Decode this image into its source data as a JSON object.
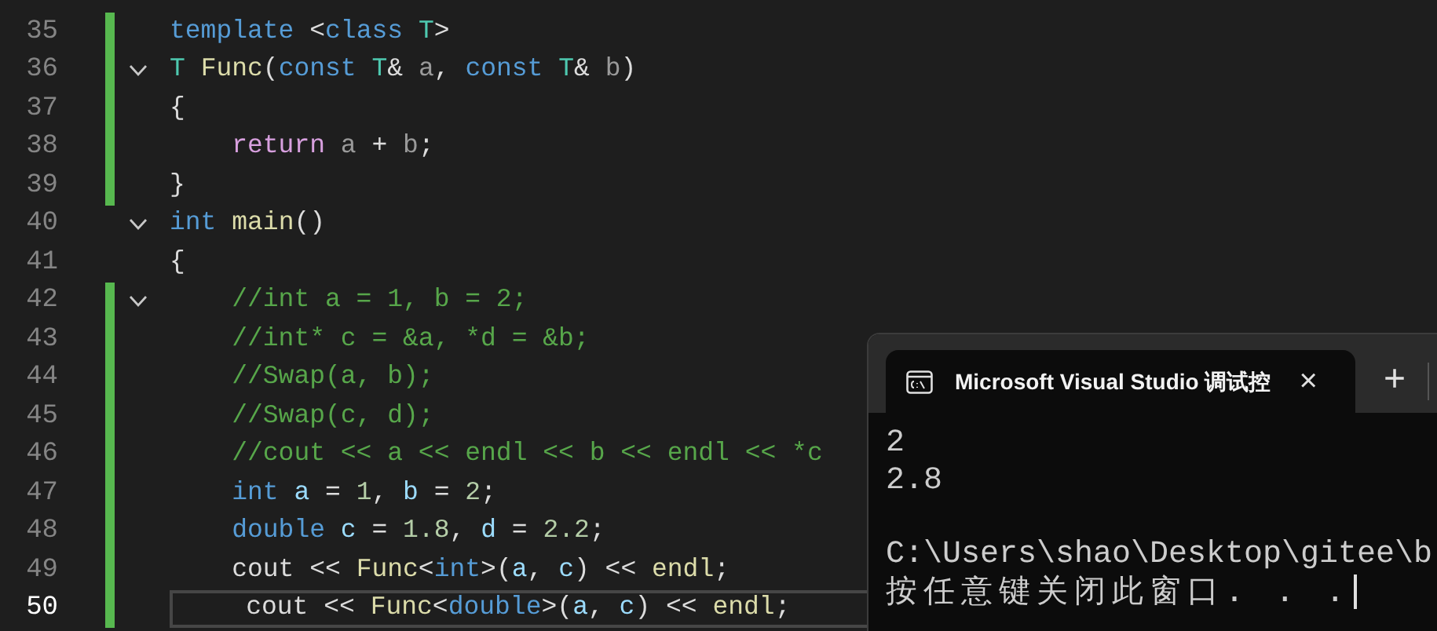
{
  "editor": {
    "lines": [
      {
        "number": "35",
        "changed": true,
        "foldable": false,
        "current": false,
        "indented": false,
        "tokens": [
          {
            "kind": "keyword",
            "text": "template "
          },
          {
            "kind": "plain",
            "text": "<"
          },
          {
            "kind": "keyword",
            "text": "class "
          },
          {
            "kind": "type",
            "text": "T"
          },
          {
            "kind": "plain",
            "text": ">"
          }
        ]
      },
      {
        "number": "36",
        "changed": true,
        "foldable": true,
        "current": false,
        "indented": false,
        "tokens": [
          {
            "kind": "type",
            "text": "T "
          },
          {
            "kind": "func",
            "text": "Func"
          },
          {
            "kind": "plain",
            "text": "("
          },
          {
            "kind": "keyword",
            "text": "const "
          },
          {
            "kind": "type",
            "text": "T"
          },
          {
            "kind": "plain",
            "text": "& "
          },
          {
            "kind": "param",
            "text": "a"
          },
          {
            "kind": "plain",
            "text": ", "
          },
          {
            "kind": "keyword",
            "text": "const "
          },
          {
            "kind": "type",
            "text": "T"
          },
          {
            "kind": "plain",
            "text": "& "
          },
          {
            "kind": "param",
            "text": "b"
          },
          {
            "kind": "plain",
            "text": ")"
          }
        ]
      },
      {
        "number": "37",
        "changed": true,
        "foldable": false,
        "current": false,
        "indented": false,
        "tokens": [
          {
            "kind": "plain",
            "text": "{"
          }
        ]
      },
      {
        "number": "38",
        "changed": true,
        "foldable": false,
        "current": false,
        "indented": true,
        "tokens": [
          {
            "kind": "control",
            "text": "return "
          },
          {
            "kind": "param",
            "text": "a"
          },
          {
            "kind": "plain",
            "text": " + "
          },
          {
            "kind": "param",
            "text": "b"
          },
          {
            "kind": "plain",
            "text": ";"
          }
        ]
      },
      {
        "number": "39",
        "changed": true,
        "foldable": false,
        "current": false,
        "indented": false,
        "tokens": [
          {
            "kind": "plain",
            "text": "}"
          }
        ]
      },
      {
        "number": "40",
        "changed": false,
        "foldable": true,
        "current": false,
        "indented": false,
        "tokens": [
          {
            "kind": "keyword",
            "text": "int "
          },
          {
            "kind": "func",
            "text": "main"
          },
          {
            "kind": "plain",
            "text": "()"
          }
        ]
      },
      {
        "number": "41",
        "changed": false,
        "foldable": false,
        "current": false,
        "indented": false,
        "tokens": [
          {
            "kind": "plain",
            "text": "{"
          }
        ]
      },
      {
        "number": "42",
        "changed": true,
        "foldable": true,
        "current": false,
        "indented": true,
        "tokens": [
          {
            "kind": "comment",
            "text": "//int a = 1, b = 2;"
          }
        ]
      },
      {
        "number": "43",
        "changed": true,
        "foldable": false,
        "current": false,
        "indented": true,
        "tokens": [
          {
            "kind": "comment",
            "text": "//int* c = &a, *d = &b;"
          }
        ]
      },
      {
        "number": "44",
        "changed": true,
        "foldable": false,
        "current": false,
        "indented": true,
        "tokens": [
          {
            "kind": "comment",
            "text": "//Swap(a, b);"
          }
        ]
      },
      {
        "number": "45",
        "changed": true,
        "foldable": false,
        "current": false,
        "indented": true,
        "tokens": [
          {
            "kind": "comment",
            "text": "//Swap(c, d);"
          }
        ]
      },
      {
        "number": "46",
        "changed": true,
        "foldable": false,
        "current": false,
        "indented": true,
        "tokens": [
          {
            "kind": "comment",
            "text": "//cout << a << endl << b << endl << *c"
          }
        ]
      },
      {
        "number": "47",
        "changed": true,
        "foldable": false,
        "current": false,
        "indented": true,
        "tokens": [
          {
            "kind": "keyword",
            "text": "int "
          },
          {
            "kind": "local",
            "text": "a"
          },
          {
            "kind": "plain",
            "text": " = "
          },
          {
            "kind": "number",
            "text": "1"
          },
          {
            "kind": "plain",
            "text": ", "
          },
          {
            "kind": "local",
            "text": "b"
          },
          {
            "kind": "plain",
            "text": " = "
          },
          {
            "kind": "number",
            "text": "2"
          },
          {
            "kind": "plain",
            "text": ";"
          }
        ]
      },
      {
        "number": "48",
        "changed": true,
        "foldable": false,
        "current": false,
        "indented": true,
        "tokens": [
          {
            "kind": "keyword",
            "text": "double "
          },
          {
            "kind": "local",
            "text": "c"
          },
          {
            "kind": "plain",
            "text": " = "
          },
          {
            "kind": "number",
            "text": "1.8"
          },
          {
            "kind": "plain",
            "text": ", "
          },
          {
            "kind": "local",
            "text": "d"
          },
          {
            "kind": "plain",
            "text": " = "
          },
          {
            "kind": "number",
            "text": "2.2"
          },
          {
            "kind": "plain",
            "text": ";"
          }
        ]
      },
      {
        "number": "49",
        "changed": true,
        "foldable": false,
        "current": false,
        "indented": true,
        "tokens": [
          {
            "kind": "plain",
            "text": "cout << "
          },
          {
            "kind": "func",
            "text": "Func"
          },
          {
            "kind": "plain",
            "text": "<"
          },
          {
            "kind": "keyword",
            "text": "int"
          },
          {
            "kind": "plain",
            "text": ">("
          },
          {
            "kind": "local",
            "text": "a"
          },
          {
            "kind": "plain",
            "text": ", "
          },
          {
            "kind": "local",
            "text": "c"
          },
          {
            "kind": "plain",
            "text": ") << "
          },
          {
            "kind": "func",
            "text": "endl"
          },
          {
            "kind": "plain",
            "text": ";"
          }
        ]
      },
      {
        "number": "50",
        "changed": true,
        "foldable": false,
        "current": true,
        "indented": true,
        "tokens": [
          {
            "kind": "plain",
            "text": "cout << "
          },
          {
            "kind": "func",
            "text": "Func"
          },
          {
            "kind": "plain",
            "text": "<"
          },
          {
            "kind": "keyword",
            "text": "double"
          },
          {
            "kind": "plain",
            "text": ">("
          },
          {
            "kind": "local",
            "text": "a"
          },
          {
            "kind": "plain",
            "text": ", "
          },
          {
            "kind": "local",
            "text": "c"
          },
          {
            "kind": "plain",
            "text": ") << "
          },
          {
            "kind": "func",
            "text": "endl"
          },
          {
            "kind": "plain",
            "text": ";"
          }
        ]
      }
    ]
  },
  "console": {
    "tab_title": "Microsoft Visual Studio 调试控",
    "close": "×",
    "new_tab": "+",
    "output": [
      {
        "text": "2",
        "blank_before": false,
        "cursor": false,
        "cjk": false
      },
      {
        "text": "2.8",
        "blank_before": false,
        "cursor": false,
        "cjk": false
      },
      {
        "text": "C:\\Users\\shao\\Desktop\\gitee\\b",
        "blank_before": true,
        "cursor": false,
        "cjk": false
      },
      {
        "text": "按任意键关闭此窗口. . .",
        "blank_before": false,
        "cursor": true,
        "cjk": true
      }
    ]
  }
}
